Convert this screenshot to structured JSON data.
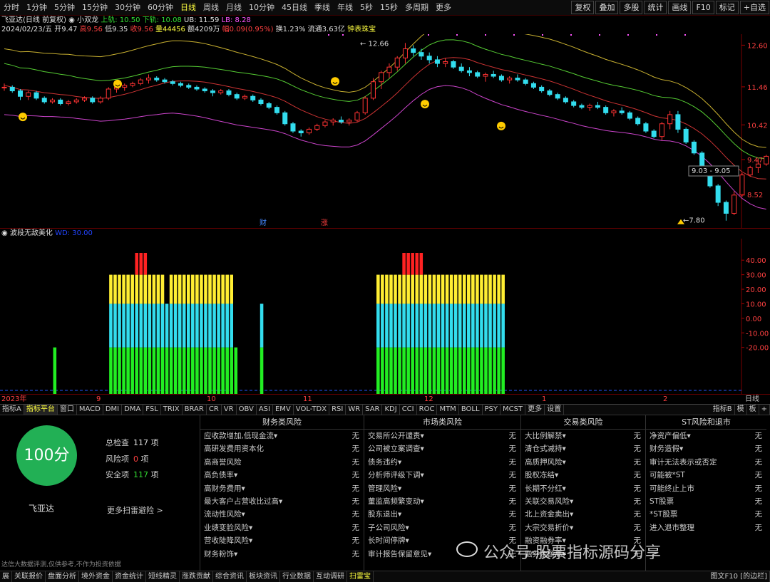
{
  "periods": [
    "分时",
    "1分钟",
    "5分钟",
    "15分钟",
    "30分钟",
    "60分钟",
    "日线",
    "周线",
    "月线",
    "10分钟",
    "45日线",
    "季线",
    "年线",
    "5秒",
    "15秒",
    "多周期",
    "更多"
  ],
  "active_period": "日线",
  "right_buttons": [
    "复权",
    "叠加",
    "多股",
    "统计",
    "画线",
    "F10",
    "标记",
    "+自选"
  ],
  "info1": {
    "name": "飞亚达(日线 前复权)",
    "indicator": "小双龙",
    "upper_label": "上轨: 10.50",
    "lower_label": "下轨: 10.08",
    "ub_label": "UB: 11.59",
    "lb_label": "LB: 8.28"
  },
  "info2": {
    "date": "2024/02/23/五",
    "open": "开9.47",
    "high": "高9.56",
    "low": "低9.35",
    "close": "收9.56",
    "vol": "量44456",
    "amount": "额4209万",
    "change": "幅0.09(0.95%)",
    "turnover": "换1.23%",
    "float": "流通3.63亿",
    "tag": "钟表珠宝"
  },
  "price_axis": [
    "12.60",
    "11.46",
    "10.42",
    "9.47",
    "8.52"
  ],
  "price_annotations": {
    "high": "12.66",
    "low": "7.80",
    "range": "9.03 - 9.05"
  },
  "event_markers": [
    "财",
    "涨"
  ],
  "indicator_title": "波段无敌美化",
  "indicator_value": "WD: 30.00",
  "ind_axis": [
    "40.00",
    "30.00",
    "20.00",
    "10.00",
    "0.00",
    "-10.00",
    "-20.00"
  ],
  "date_labels": [
    "2023年",
    "9",
    "10",
    "11",
    "12",
    "1",
    "2"
  ],
  "period_label_right": "日线",
  "ind_tabs": [
    "指标A",
    "指标平台",
    "窗口",
    "MACD",
    "DMI",
    "DMA",
    "FSL",
    "TRIX",
    "BRAR",
    "CR",
    "VR",
    "OBV",
    "ASI",
    "EMV",
    "VOL-TDX",
    "RSI",
    "WR",
    "SAR",
    "KDJ",
    "CCI",
    "ROC",
    "MTM",
    "BOLL",
    "PSY",
    "MCST",
    "更多",
    "设置"
  ],
  "ind_tabs_right": [
    "指标B",
    "模",
    "板",
    "+"
  ],
  "score": {
    "value": "100分",
    "name": "飞亚达",
    "total_label": "总检查",
    "total": "117",
    "total_unit": "项",
    "risk_label": "风险项",
    "risk": "0",
    "risk_unit": "项",
    "safe_label": "安全项",
    "safe": "117",
    "safe_unit": "项",
    "more": "更多扫雷避险 >",
    "disclaimer": "达信大数据评测,仅供参考,不作为投资依据"
  },
  "risk_columns": [
    {
      "title": "财务类风险",
      "items": [
        "应收款增加,低现金流▾",
        "高研发费用资本化",
        "高商誉风险",
        "高负债率▾",
        "高财务费用▾",
        "最大客户占营收比过高▾",
        "流动性风险▾",
        "业绩变脸风险▾",
        "营收陡降风险▾",
        "财务粉饰▾"
      ]
    },
    {
      "title": "市场类风险",
      "items": [
        "交易所公开谴责▾",
        "公司被立案调查▾",
        "债务违约▾",
        "分析师评级下调▾",
        "管理风险▾",
        "董监高频繁变动▾",
        "股东退出▾",
        "子公司风险▾",
        "长时间停牌▾",
        "审计报告保留意见▾"
      ]
    },
    {
      "title": "交易类风险",
      "items": [
        "大比例解禁▾",
        "清仓式减持▾",
        "高质押风险▾",
        "股权冻结▾",
        "长期不分红▾",
        "关联交易风险▾",
        "北上资金卖出▾",
        "大宗交易折价▾",
        "融资融券率▾",
        "融券余额高▾"
      ]
    },
    {
      "title": "ST风险和退市",
      "items": [
        "净资产偏低▾",
        "财务造假▾",
        "审计无法表示或否定",
        "可能被*ST",
        "可能终止上市",
        "ST股票",
        "*ST股票",
        "进入退市整理"
      ]
    }
  ],
  "risk_value": "无",
  "watermark": "公众号·股票指标源码分享",
  "status_items": [
    "展",
    "关联报价",
    "盘面分析",
    "境外资金",
    "资金统计",
    "短线精灵",
    "涨跌贡献",
    "综合资讯",
    "板块资讯",
    "行业数据",
    "互动调研",
    "扫雷宝"
  ],
  "status_active": "扫雷宝",
  "status_right": "图文F10 [的边栏]",
  "candles": [
    [
      11.45,
      11.55,
      11.35,
      11.45
    ],
    [
      11.45,
      11.5,
      11.3,
      11.35
    ],
    [
      11.35,
      11.4,
      11.1,
      11.2
    ],
    [
      11.2,
      11.35,
      11.1,
      11.3
    ],
    [
      11.3,
      11.35,
      11.1,
      11.15
    ],
    [
      11.15,
      11.2,
      11.0,
      11.05
    ],
    [
      11.05,
      11.15,
      11.0,
      11.1
    ],
    [
      11.1,
      11.15,
      10.95,
      11.0
    ],
    [
      11.0,
      11.1,
      10.95,
      11.05
    ],
    [
      11.05,
      11.15,
      11.0,
      11.1
    ],
    [
      11.1,
      11.2,
      11.05,
      11.15
    ],
    [
      11.15,
      11.2,
      11.0,
      11.05
    ],
    [
      11.05,
      11.2,
      11.0,
      11.15
    ],
    [
      11.15,
      11.45,
      11.1,
      11.4
    ],
    [
      11.4,
      11.5,
      11.3,
      11.45
    ],
    [
      11.45,
      11.55,
      11.35,
      11.5
    ],
    [
      11.5,
      11.6,
      11.45,
      11.55
    ],
    [
      11.55,
      11.7,
      11.5,
      11.65
    ],
    [
      11.65,
      11.8,
      11.55,
      11.7
    ],
    [
      11.7,
      11.75,
      11.6,
      11.65
    ],
    [
      11.65,
      11.7,
      11.55,
      11.6
    ],
    [
      11.6,
      11.65,
      11.5,
      11.55
    ],
    [
      11.55,
      11.6,
      11.45,
      11.5
    ],
    [
      11.5,
      11.55,
      11.4,
      11.45
    ],
    [
      11.45,
      11.5,
      11.35,
      11.4
    ],
    [
      11.4,
      11.45,
      11.3,
      11.35
    ],
    [
      11.35,
      11.4,
      11.2,
      11.3
    ],
    [
      11.3,
      11.4,
      11.25,
      11.35
    ],
    [
      11.35,
      11.4,
      11.2,
      11.25
    ],
    [
      11.25,
      11.3,
      11.1,
      11.15
    ],
    [
      11.15,
      11.25,
      11.1,
      11.2
    ],
    [
      11.2,
      11.25,
      11.05,
      11.1
    ],
    [
      11.1,
      11.15,
      10.95,
      11.0
    ],
    [
      11.0,
      11.05,
      10.85,
      10.9
    ],
    [
      10.9,
      10.95,
      10.7,
      10.75
    ],
    [
      10.75,
      10.8,
      10.4,
      10.45
    ],
    [
      10.45,
      10.5,
      10.2,
      10.25
    ],
    [
      10.25,
      10.3,
      10.1,
      10.2
    ],
    [
      10.2,
      10.35,
      10.15,
      10.3
    ],
    [
      10.3,
      10.45,
      10.25,
      10.4
    ],
    [
      10.4,
      10.55,
      10.35,
      10.5
    ],
    [
      10.5,
      10.6,
      10.4,
      10.55
    ],
    [
      10.55,
      10.65,
      10.45,
      10.5
    ],
    [
      10.5,
      10.6,
      10.4,
      10.55
    ],
    [
      10.55,
      10.8,
      10.5,
      10.75
    ],
    [
      10.75,
      11.2,
      10.7,
      11.15
    ],
    [
      11.15,
      11.7,
      11.1,
      11.6
    ],
    [
      11.6,
      11.9,
      11.4,
      11.85
    ],
    [
      11.85,
      12.1,
      11.7,
      12.0
    ],
    [
      12.0,
      12.3,
      11.9,
      12.25
    ],
    [
      12.25,
      12.66,
      12.1,
      12.5
    ],
    [
      12.5,
      12.6,
      12.3,
      12.4
    ],
    [
      12.4,
      12.5,
      12.2,
      12.3
    ],
    [
      12.3,
      12.4,
      12.1,
      12.2
    ],
    [
      12.2,
      12.3,
      12.0,
      12.1
    ],
    [
      12.1,
      12.25,
      12.0,
      12.15
    ],
    [
      12.15,
      12.2,
      11.95,
      12.0
    ],
    [
      12.0,
      12.1,
      11.85,
      11.9
    ],
    [
      11.9,
      12.0,
      11.75,
      11.85
    ],
    [
      11.85,
      11.9,
      11.7,
      11.75
    ],
    [
      11.75,
      11.85,
      11.6,
      11.8
    ],
    [
      11.8,
      11.9,
      11.7,
      11.75
    ],
    [
      11.75,
      11.8,
      11.6,
      11.65
    ],
    [
      11.65,
      11.75,
      11.55,
      11.7
    ],
    [
      11.7,
      11.8,
      11.6,
      11.65
    ],
    [
      11.65,
      11.7,
      11.5,
      11.55
    ],
    [
      11.55,
      11.6,
      11.4,
      11.45
    ],
    [
      11.45,
      11.5,
      11.3,
      11.35
    ],
    [
      11.35,
      11.4,
      11.2,
      11.25
    ],
    [
      11.25,
      11.3,
      11.1,
      11.15
    ],
    [
      11.15,
      11.2,
      11.0,
      11.05
    ],
    [
      11.05,
      11.1,
      10.9,
      10.95
    ],
    [
      10.95,
      11.0,
      10.85,
      10.9
    ],
    [
      10.9,
      11.0,
      10.8,
      10.95
    ],
    [
      10.95,
      11.05,
      10.85,
      10.9
    ],
    [
      10.9,
      10.95,
      10.7,
      10.75
    ],
    [
      10.75,
      10.85,
      10.65,
      10.8
    ],
    [
      10.8,
      10.9,
      10.7,
      10.75
    ],
    [
      10.75,
      10.8,
      10.55,
      10.6
    ],
    [
      10.6,
      10.65,
      10.4,
      10.45
    ],
    [
      10.45,
      10.5,
      10.2,
      10.25
    ],
    [
      10.25,
      10.3,
      10.05,
      10.1
    ],
    [
      10.1,
      10.5,
      10.0,
      10.45
    ],
    [
      10.45,
      10.8,
      10.3,
      10.7
    ],
    [
      10.7,
      10.8,
      10.2,
      10.3
    ],
    [
      10.3,
      10.35,
      9.9,
      9.95
    ],
    [
      9.95,
      10.0,
      9.6,
      9.65
    ],
    [
      9.65,
      9.7,
      9.2,
      9.25
    ],
    [
      9.25,
      9.3,
      8.7,
      8.75
    ],
    [
      8.75,
      8.8,
      8.2,
      8.3
    ],
    [
      8.3,
      8.35,
      7.8,
      8.0
    ],
    [
      8.0,
      8.6,
      7.95,
      8.5
    ],
    [
      8.5,
      9.1,
      8.45,
      9.05
    ],
    [
      9.05,
      9.3,
      9.0,
      9.25
    ],
    [
      9.25,
      9.5,
      9.1,
      9.35
    ],
    [
      9.35,
      9.6,
      9.3,
      9.56
    ]
  ],
  "ind_bars": [
    -32,
    -32,
    -32,
    -32,
    -32,
    -32,
    -32,
    -32,
    -32,
    -32,
    -32,
    -32,
    -32,
    -32,
    -32,
    -32,
    -32,
    -32,
    -32,
    -32,
    -32,
    -32,
    -32,
    -32,
    -32,
    -32,
    -32,
    -32,
    -32,
    -32,
    -32,
    -32,
    -32,
    -32,
    -32,
    -32,
    -32,
    -32,
    -32,
    -32,
    -32,
    -32,
    -32,
    -32,
    -32,
    -32,
    -32,
    -32,
    -32,
    -32,
    -32,
    -32,
    -32,
    -32,
    -32,
    -32,
    -32,
    -32,
    -32,
    -32,
    -32,
    -32
  ],
  "wave": [
    0,
    0,
    0,
    0,
    0,
    0,
    0,
    0,
    0,
    0,
    0,
    0,
    1,
    0,
    0,
    0,
    0,
    0,
    0,
    0,
    0,
    0,
    0,
    0,
    0,
    3,
    3,
    3,
    4,
    4,
    4,
    5,
    5,
    5,
    4,
    4,
    4,
    4,
    2,
    4,
    4,
    4,
    4,
    4,
    4,
    4,
    4,
    4,
    4,
    4,
    4,
    4,
    4,
    4,
    1,
    0,
    0,
    0,
    0,
    0,
    2,
    0,
    0,
    0,
    0,
    0,
    0,
    0,
    0,
    0,
    0,
    0,
    0,
    0,
    0,
    0,
    0,
    0,
    0,
    0,
    0,
    0,
    0,
    0,
    0,
    0,
    0,
    3,
    3,
    3,
    4,
    4,
    4,
    5,
    5,
    5,
    5,
    5,
    4,
    4,
    4,
    4,
    4,
    4,
    4,
    4,
    4,
    4,
    4,
    4,
    4,
    4,
    4,
    4,
    4,
    4,
    3,
    0,
    0,
    0,
    0,
    0,
    0,
    0,
    0,
    0,
    0,
    0,
    0,
    0,
    0,
    0,
    0,
    0,
    0,
    0,
    0,
    0,
    0,
    0,
    0,
    0,
    0,
    0,
    0,
    0,
    0,
    0,
    0,
    0,
    0,
    0,
    0,
    0,
    0,
    0,
    0,
    0,
    0,
    0,
    0,
    0,
    0,
    0,
    0,
    0,
    0,
    0,
    0,
    0,
    0,
    0
  ]
}
